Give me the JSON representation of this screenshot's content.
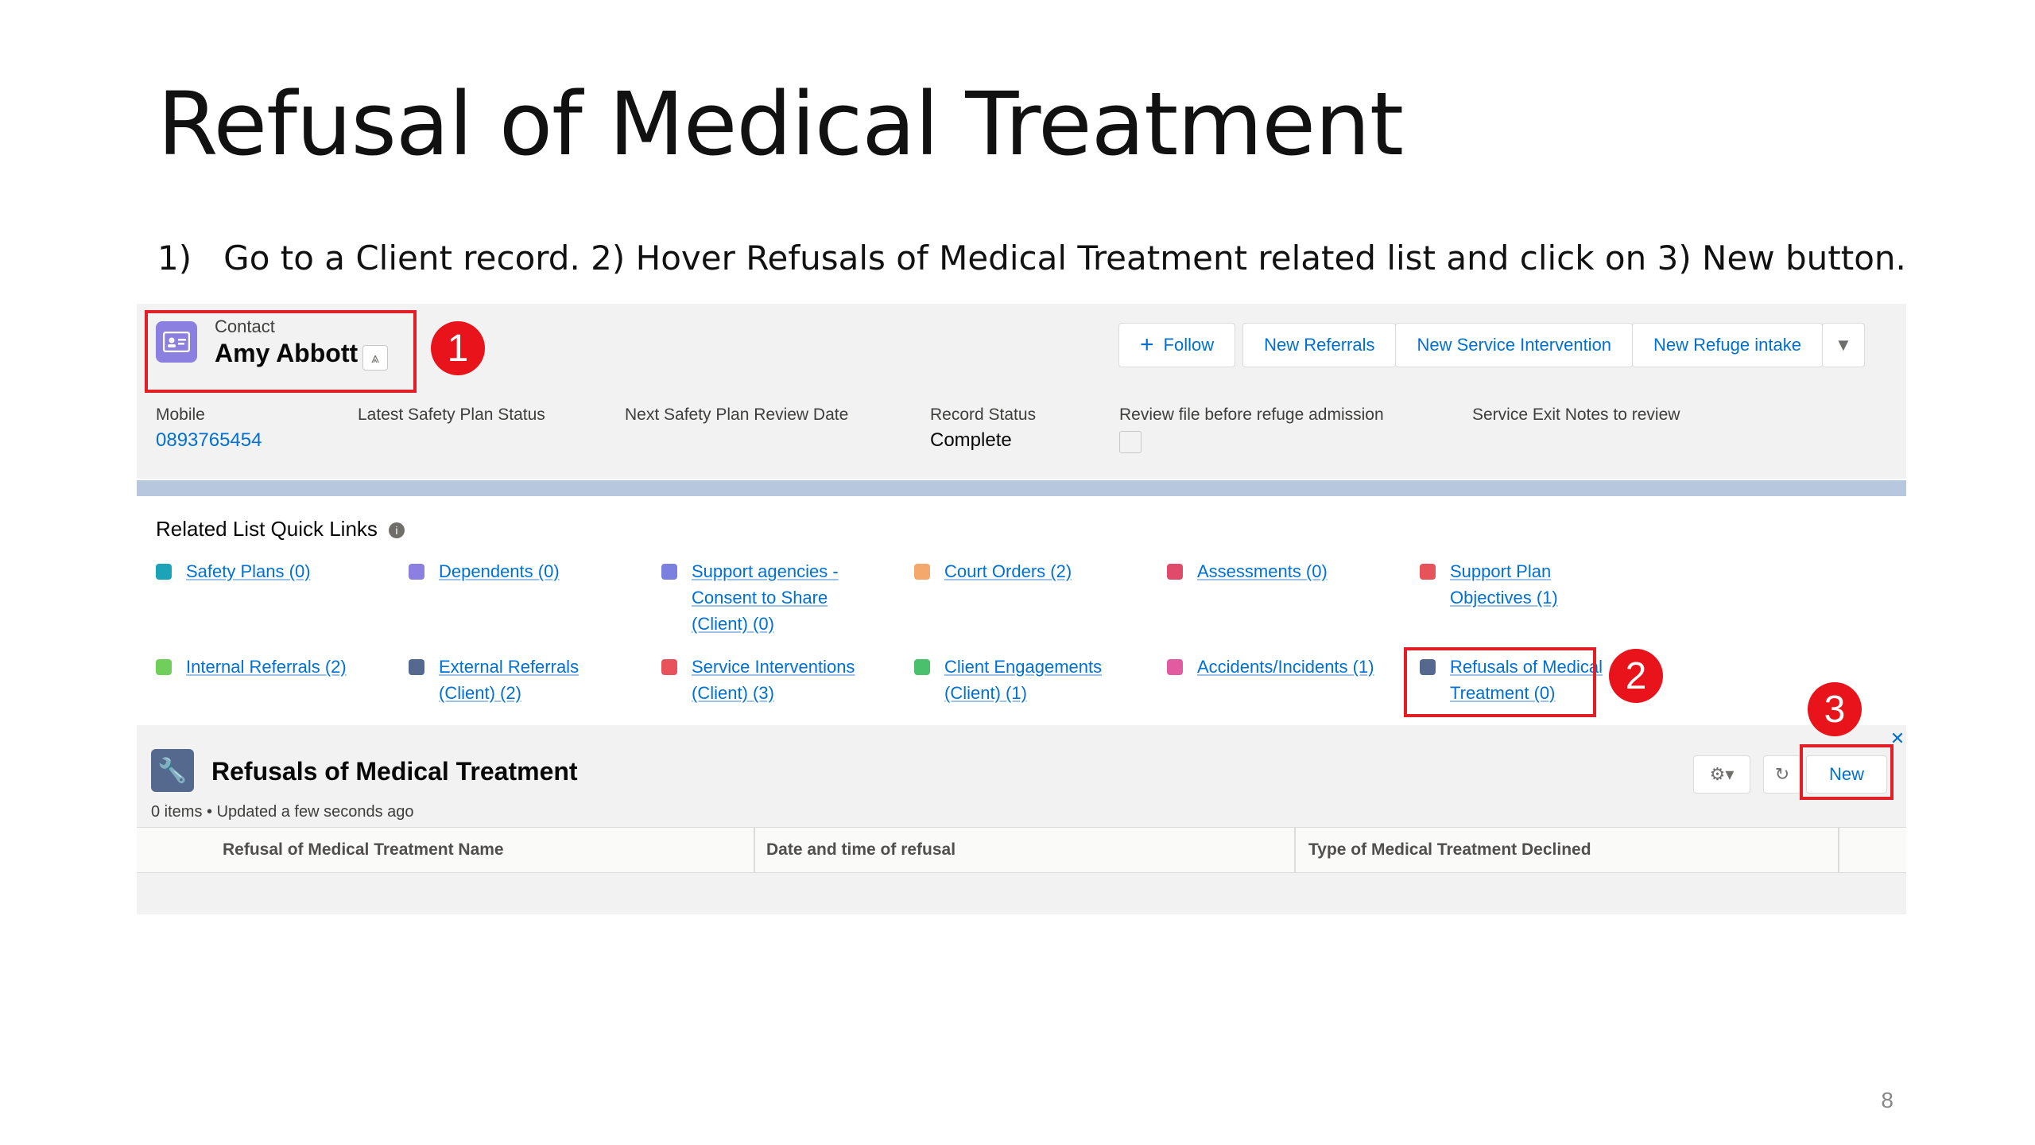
{
  "slide": {
    "title": "Refusal of Medical Treatment",
    "instructions": "1)   Go to a Client record. 2) Hover Refusals of Medical Treatment related list and click on 3) New button.",
    "page_number": "8"
  },
  "record_header": {
    "object_label": "Contact",
    "record_name": "Amy Abbott",
    "hierarchy_icon": "hierarchy-icon",
    "buttons": {
      "follow": "Follow",
      "new_referrals": "New Referrals",
      "new_service_intervention": "New Service Intervention",
      "new_refuge_intake": "New Refuge intake"
    },
    "fields": [
      {
        "label": "Mobile",
        "value": "0893765454"
      },
      {
        "label": "Latest Safety Plan Status",
        "value": ""
      },
      {
        "label": "Next Safety Plan Review Date",
        "value": ""
      },
      {
        "label": "Record Status",
        "value": "Complete"
      },
      {
        "label": "Review file before refuge admission",
        "value": ""
      },
      {
        "label": "Service Exit Notes to review",
        "value": ""
      }
    ]
  },
  "quick_links": {
    "title": "Related List Quick Links",
    "items": [
      {
        "line1": "Safety Plans (0)",
        "line2": "",
        "line3": "",
        "color": "#1ba4b8"
      },
      {
        "line1": "Dependents (0)",
        "line2": "",
        "line3": "",
        "color": "#8b7fe0"
      },
      {
        "line1": "Support agencies -",
        "line2": "Consent to Share",
        "line3": "(Client) (0)",
        "color": "#7b7fe0"
      },
      {
        "line1": "Court Orders (2)",
        "line2": "",
        "line3": "",
        "color": "#f5a86b"
      },
      {
        "line1": "Assessments (0)",
        "line2": "",
        "line3": "",
        "color": "#e04a6b"
      },
      {
        "line1": "Support Plan",
        "line2": "Objectives (1)",
        "line3": "",
        "color": "#e8525a"
      },
      {
        "line1": "Internal Referrals (2)",
        "line2": "",
        "line3": "",
        "color": "#6fcf5a"
      },
      {
        "line1": "External Referrals",
        "line2": "(Client) (2)",
        "line3": "",
        "color": "#54698d"
      },
      {
        "line1": "Service Interventions",
        "line2": "(Client) (3)",
        "line3": "",
        "color": "#e8525a"
      },
      {
        "line1": "Client Engagements",
        "line2": "(Client) (1)",
        "line3": "",
        "color": "#4bc06c"
      },
      {
        "line1": "Accidents/Incidents (1)",
        "line2": "",
        "line3": "",
        "color": "#e25aa0"
      },
      {
        "line1": "Refusals of Medical",
        "line2": "Treatment (0)",
        "line3": "",
        "color": "#54698d"
      }
    ]
  },
  "related_list": {
    "title": "Refusals of Medical Treatment",
    "subtitle": "0 items • Updated a few seconds ago",
    "new_label": "New",
    "columns": [
      "Refusal of Medical Treatment Name",
      "Date and time of refusal",
      "Type of Medical Treatment Declined"
    ]
  },
  "callouts": [
    "1",
    "2",
    "3"
  ],
  "colors": {
    "accent_red": "#e21e26",
    "link_blue": "#0070d2",
    "contact_icon": "#8b7fe0"
  }
}
